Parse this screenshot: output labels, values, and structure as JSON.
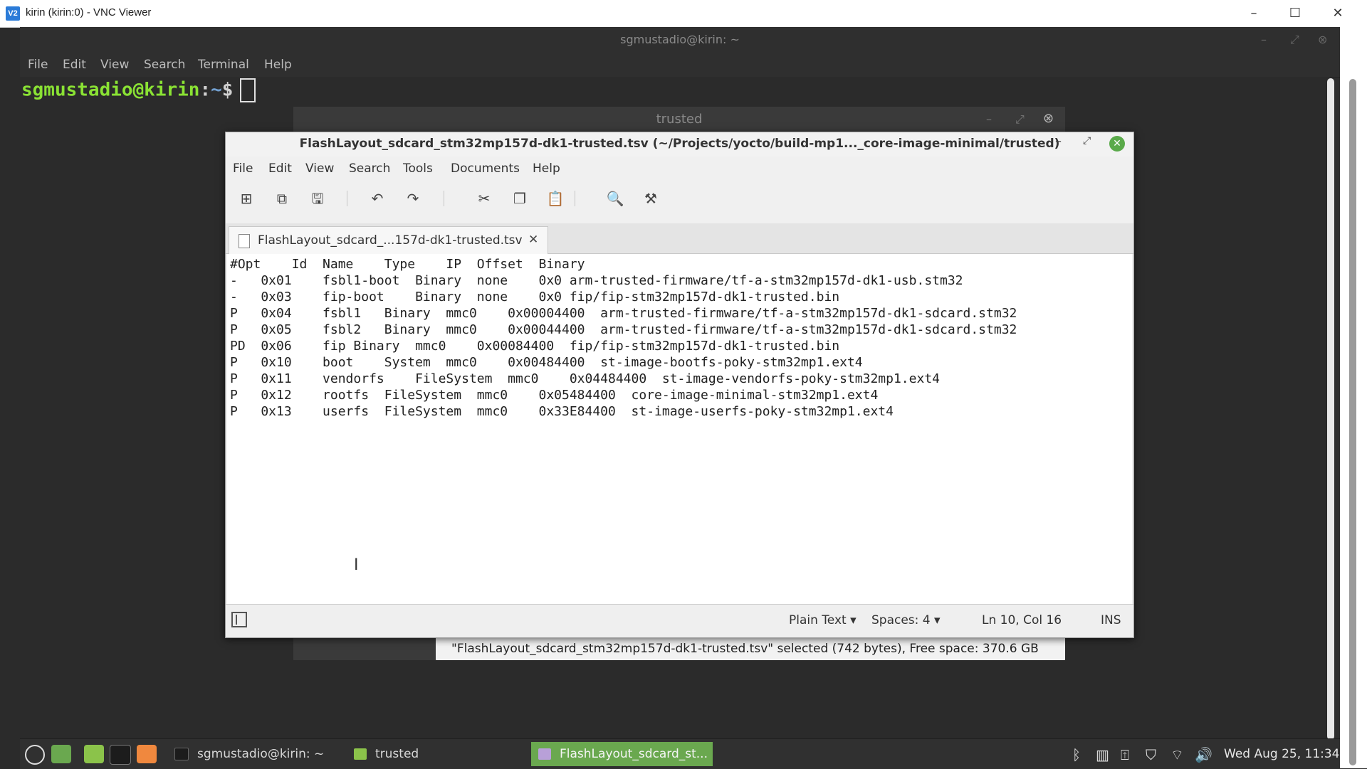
{
  "vnc": {
    "icon_text": "V2",
    "title": "kirin (kirin:0) - VNC Viewer",
    "minimize": "–",
    "maximize": "☐",
    "close": "✕"
  },
  "terminal": {
    "title": "sgmustadio@kirin: ~",
    "menu": [
      "File",
      "Edit",
      "View",
      "Search",
      "Terminal",
      "Help"
    ],
    "prompt_user": "sgmustadio@kirin",
    "prompt_sep": ":",
    "prompt_path": "~",
    "prompt_dollar": "$"
  },
  "nemo": {
    "title": "trusted",
    "status": "\"FlashLayout_sdcard_stm32mp157d-dk1-trusted.tsv\" selected (742 bytes), Free space: 370.6 GB"
  },
  "editor": {
    "title": "FlashLayout_sdcard_stm32mp157d-dk1-trusted.tsv (~/Projects/yocto/build-mp1..._core-image-minimal/trusted)",
    "menu": [
      "File",
      "Edit",
      "View",
      "Search",
      "Tools",
      "Documents",
      "Help"
    ],
    "tab_label": "FlashLayout_sdcard_...157d-dk1-trusted.tsv",
    "lines": [
      "#Opt    Id  Name    Type    IP  Offset  Binary",
      "-   0x01    fsbl1-boot  Binary  none    0x0 arm-trusted-firmware/tf-a-stm32mp157d-dk1-usb.stm32",
      "-   0x03    fip-boot    Binary  none    0x0 fip/fip-stm32mp157d-dk1-trusted.bin",
      "P   0x04    fsbl1   Binary  mmc0    0x00004400  arm-trusted-firmware/tf-a-stm32mp157d-dk1-sdcard.stm32",
      "P   0x05    fsbl2   Binary  mmc0    0x00044400  arm-trusted-firmware/tf-a-stm32mp157d-dk1-sdcard.stm32",
      "PD  0x06    fip Binary  mmc0    0x00084400  fip/fip-stm32mp157d-dk1-trusted.bin",
      "P   0x10    boot    System  mmc0    0x00484400  st-image-bootfs-poky-stm32mp1.ext4",
      "P   0x11    vendorfs    FileSystem  mmc0    0x04484400  st-image-vendorfs-poky-stm32mp1.ext4",
      "P   0x12    rootfs  FileSystem  mmc0    0x05484400  core-image-minimal-stm32mp1.ext4",
      "P   0x13    userfs  FileSystem  mmc0    0x33E84400  st-image-userfs-poky-stm32mp1.ext4"
    ],
    "status": {
      "language": "Plain Text ▾",
      "spaces": "Spaces: 4 ▾",
      "position": "Ln 10, Col 16",
      "mode": "INS"
    }
  },
  "taskbar": {
    "tasks": [
      "sgmustadio@kirin: ~",
      "trusted",
      "FlashLayout_sdcard_st..."
    ],
    "clock": "Wed Aug 25, 11:34"
  }
}
